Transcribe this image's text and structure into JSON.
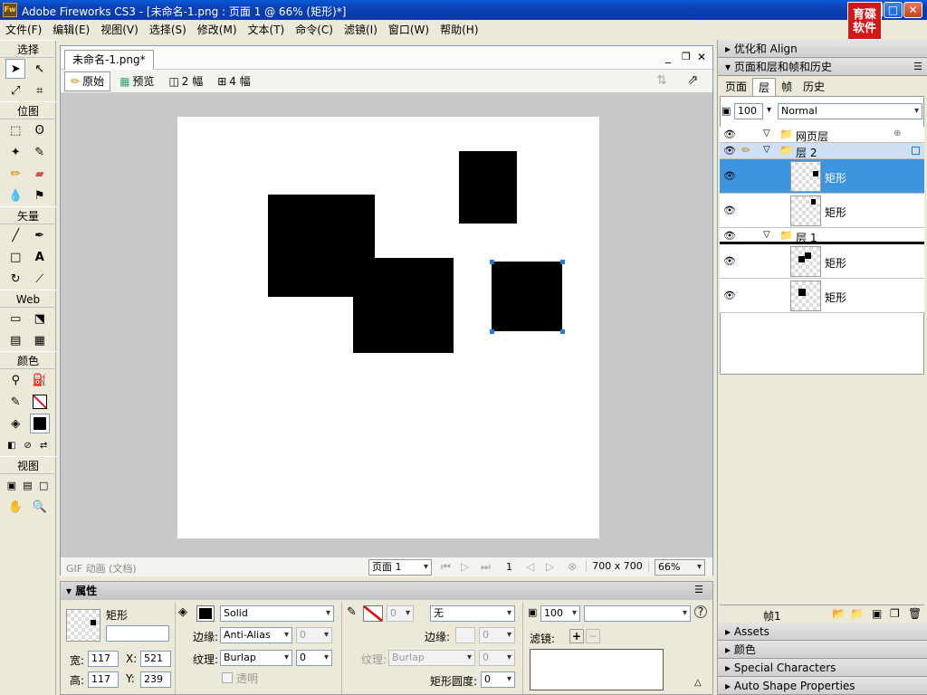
{
  "window": {
    "title": "Adobe Fireworks CS3 - [未命名-1.png : 页面 1 @  66% (矩形)*]",
    "app_icon": "Fw",
    "logo_text": "育碟\n软件"
  },
  "menu": [
    "文件(F)",
    "编辑(E)",
    "视图(V)",
    "选择(S)",
    "修改(M)",
    "文本(T)",
    "命令(C)",
    "滤镜(I)",
    "窗口(W)",
    "帮助(H)"
  ],
  "toolbox": {
    "select": "选择",
    "bitmap": "位图",
    "vector": "矢量",
    "web": "Web",
    "colors": "颜色",
    "view": "视图"
  },
  "document": {
    "tab": "未命名-1.png*",
    "views": [
      "原始",
      "预览",
      "2 幅",
      "4 幅"
    ],
    "status_left": "GIF 动画 (文档)",
    "page_select": "页面 1",
    "frame_num": "1",
    "canvas_size": "700 x 700",
    "zoom": "66%"
  },
  "properties": {
    "title": "属性",
    "obj_name": "矩形",
    "w_label": "宽:",
    "w": "117",
    "h_label": "高:",
    "h": "117",
    "x_label": "X:",
    "x": "521",
    "y_label": "Y:",
    "y": "239",
    "fill_type": "Solid",
    "edge_label": "边缘:",
    "edge": "Anti-Alias",
    "edge_val": "0",
    "texture_label": "纹理:",
    "texture": "Burlap",
    "texture_val": "0",
    "transparent": "透明",
    "stroke": "无",
    "stroke_size": "0",
    "stroke_edge_label": "边缘:",
    "stroke_edge": "0",
    "stroke_texture_label": "纹理:",
    "stroke_texture": "Burlap",
    "stroke_texture_val": "0",
    "roundness_label": "矩形圆度:",
    "roundness": "0",
    "opacity": "100",
    "filter_label": "滤镜:"
  },
  "panels": {
    "optimize": "优化和 Align",
    "layers_group": "页面和层和帧和历史",
    "tabs": [
      "页面",
      "层",
      "帧",
      "历史"
    ],
    "opacity": "100",
    "blend": "Normal",
    "web_layer": "网页层",
    "layer2": "层 2",
    "layer1": "层 1",
    "object_name": "矩形",
    "frame": "帧1",
    "assets": "Assets",
    "colors": "颜色",
    "special_chars": "Special Characters",
    "auto_shape": "Auto Shape Properties"
  },
  "colors": {
    "selection": "#3d95de",
    "accent_blue": "#1e7be0"
  }
}
